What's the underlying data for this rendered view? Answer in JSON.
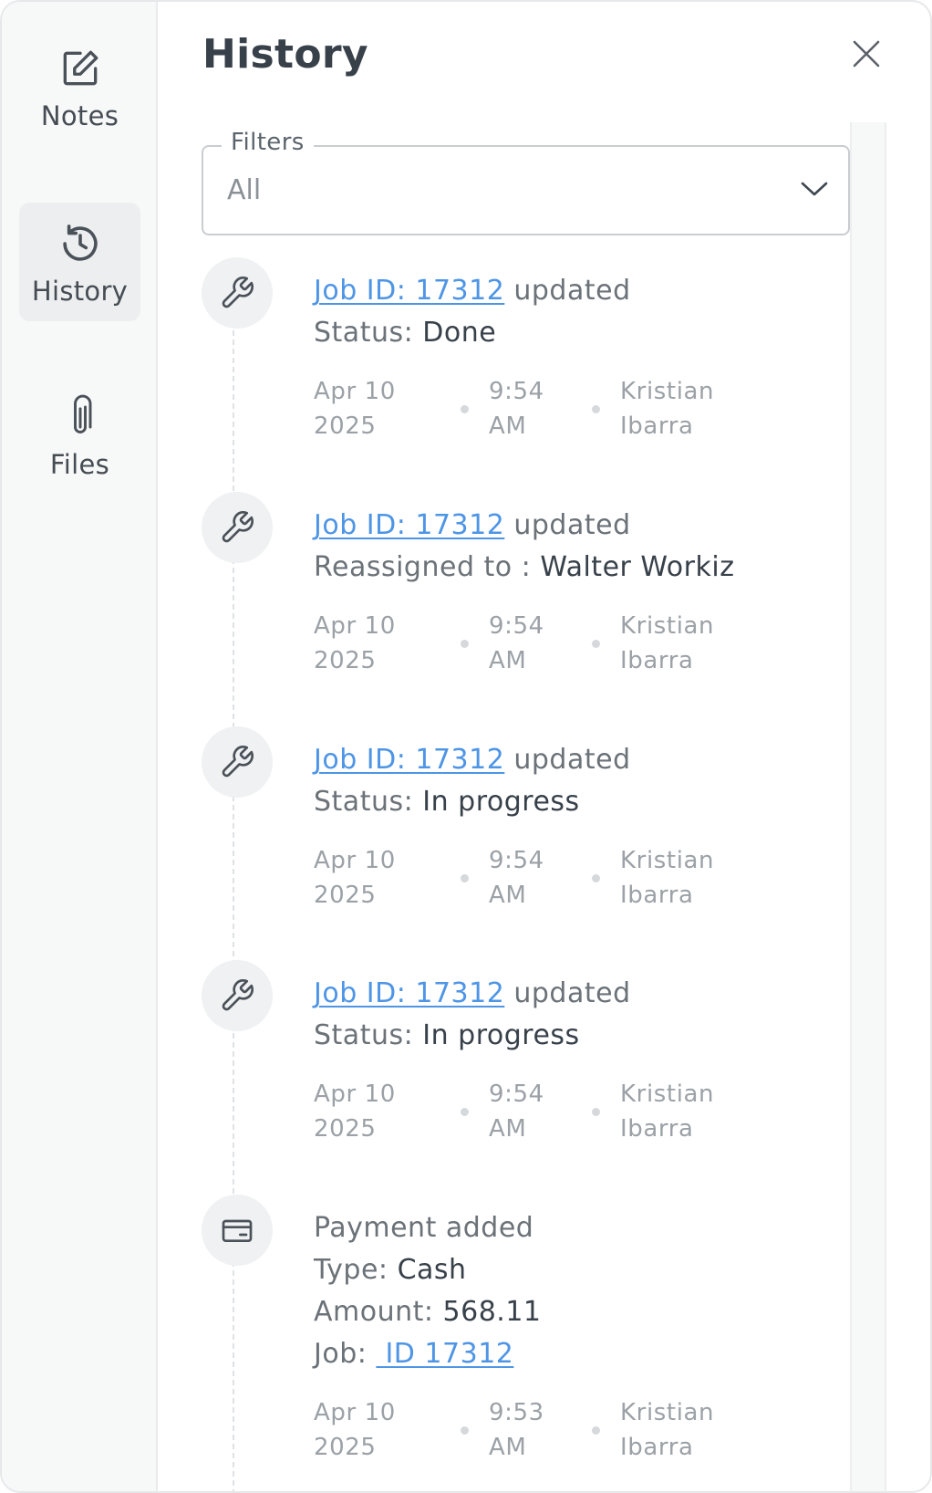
{
  "sidebar": {
    "items": [
      {
        "label": "Notes",
        "icon": "edit-note-icon",
        "active": false
      },
      {
        "label": "History",
        "icon": "history-icon",
        "active": true
      },
      {
        "label": "Files",
        "icon": "paperclip-icon",
        "active": false
      }
    ]
  },
  "header": {
    "title": "History",
    "close_icon": "close-icon"
  },
  "filter": {
    "label": "Filters",
    "value": "All"
  },
  "colors": {
    "link": "#4e95e6",
    "text": "#38414a",
    "muted": "#9ba1a6"
  },
  "entries": [
    {
      "icon": "wrench-icon",
      "link": "Job ID: 17312",
      "action": "updated",
      "detail_label": "Status:",
      "detail_value": "Done",
      "date": "Apr 10 2025",
      "time": "9:54 AM",
      "user": "Kristian Ibarra"
    },
    {
      "icon": "wrench-icon",
      "link": "Job ID: 17312",
      "action": "updated",
      "detail_label": "Reassigned to :",
      "detail_value": "Walter Workiz",
      "date": "Apr 10 2025",
      "time": "9:54 AM",
      "user": "Kristian Ibarra"
    },
    {
      "icon": "wrench-icon",
      "link": "Job ID: 17312",
      "action": "updated",
      "detail_label": "Status:",
      "detail_value": "In progress",
      "date": "Apr 10 2025",
      "time": "9:54 AM",
      "user": "Kristian Ibarra"
    },
    {
      "icon": "wrench-icon",
      "link": "Job ID: 17312",
      "action": "updated",
      "detail_label": "Status:",
      "detail_value": "In progress",
      "date": "Apr 10 2025",
      "time": "9:54 AM",
      "user": "Kristian Ibarra"
    },
    {
      "icon": "credit-card-icon",
      "title": "Payment added",
      "type_label": "Type:",
      "type_value": "Cash",
      "amount_label": "Amount:",
      "amount_value": "568.11",
      "job_label": "Job:",
      "job_link": " ID 17312",
      "date": "Apr 10 2025",
      "time": "9:53 AM",
      "user": "Kristian Ibarra"
    }
  ]
}
